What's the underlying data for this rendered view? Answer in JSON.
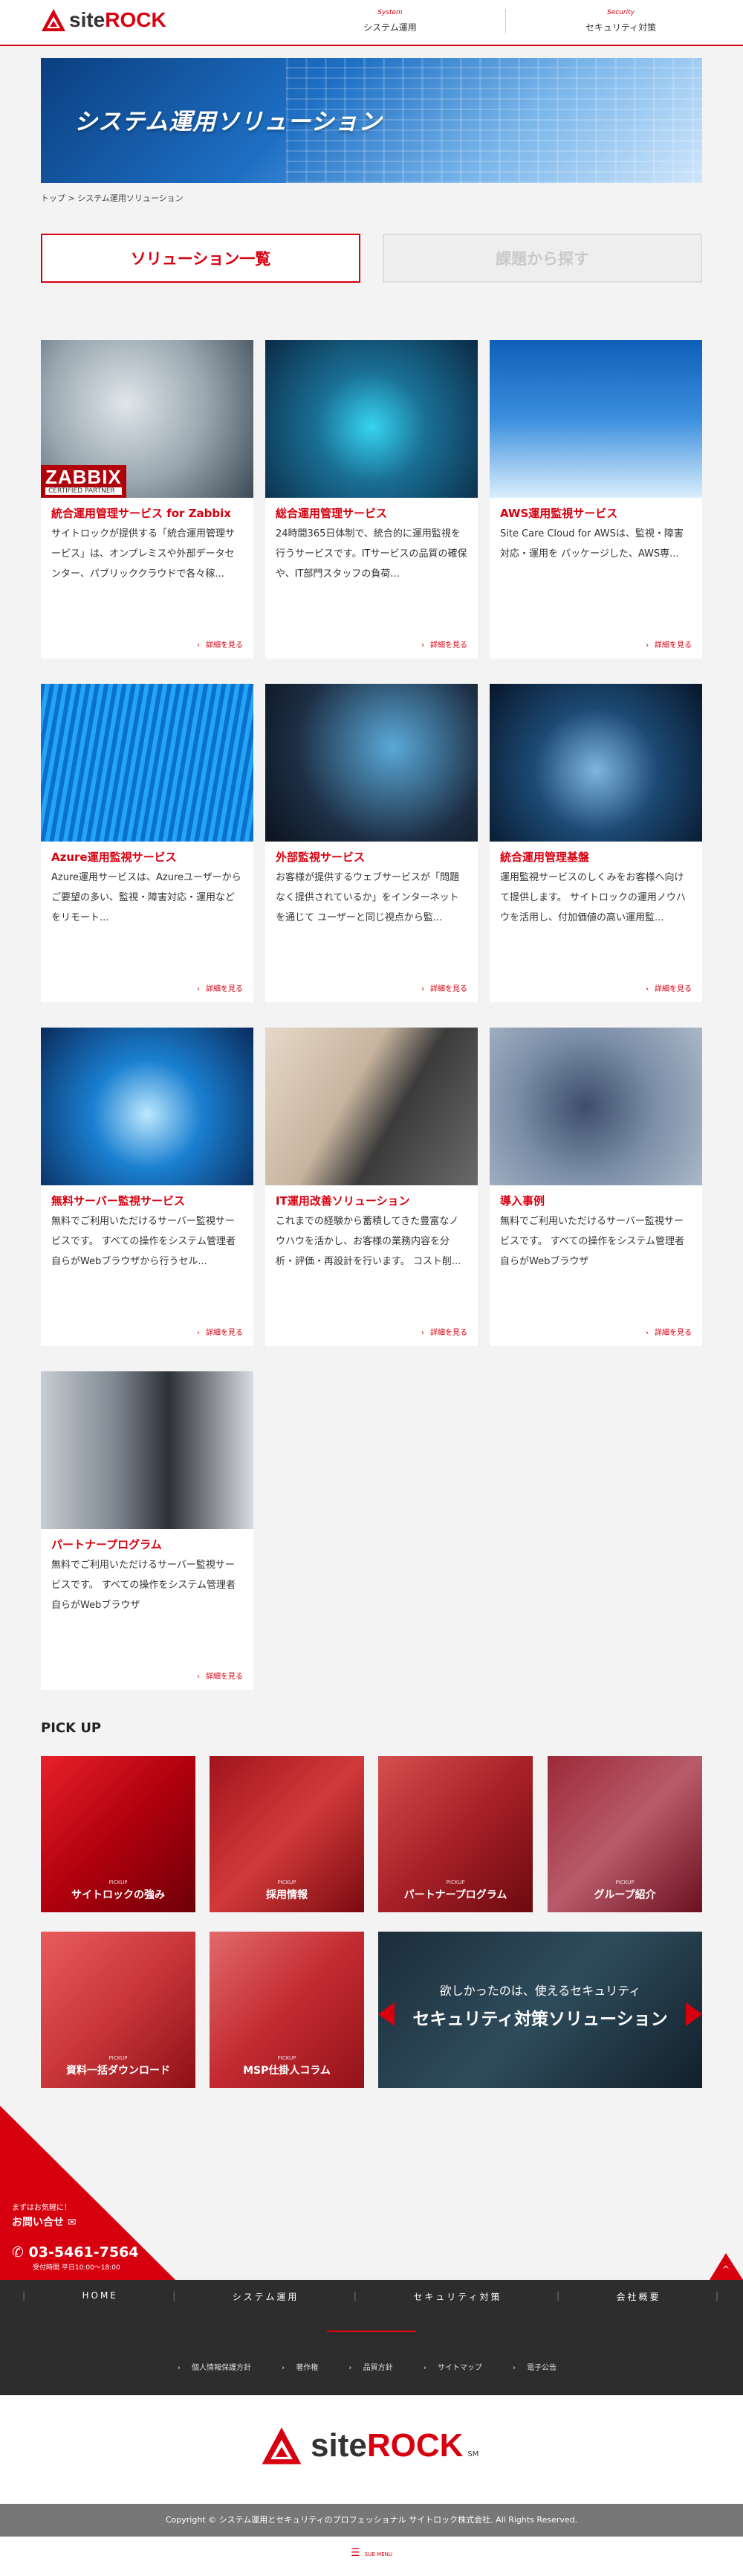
{
  "brand": {
    "logo_site": "site",
    "logo_rock": "ROCK",
    "footer_mark": "SM"
  },
  "gnav": [
    {
      "en": "System",
      "ja": "システム運用"
    },
    {
      "en": "Security",
      "ja": "セキュリティ対策"
    }
  ],
  "hero": {
    "title": "システム運用ソリューション"
  },
  "breadcrumb": "トップ > システム運用ソリューション",
  "tabs": {
    "list": "ソリューション一覧",
    "find": "課題から探す"
  },
  "cards": [
    {
      "title": "統合運用管理サービス for Zabbix",
      "desc": "サイトロックが提供する「統合運用管理サービス」は、オンプレミスや外部データセンター、パブリッククラウドで各々稼...",
      "more": "詳細を見る",
      "badge": "ZABBIX",
      "badge_sub": "CERTIFIED PARTNER"
    },
    {
      "title": "総合運用管理サービス",
      "desc": "24時間365日体制で、統合的に運用監視を行うサービスです。ITサービスの品質の確保や、IT部門スタッフの負荷...",
      "more": "詳細を見る"
    },
    {
      "title": "AWS運用監視サービス",
      "desc": "Site Care Cloud for AWSは、監視・障害対応・運用を パッケージした、AWS専...",
      "more": "詳細を見る"
    },
    {
      "title": "Azure運用監視サービス",
      "desc": "Azure運用サービスは、Azureユーザーからご要望の多い、監視・障害対応・運用などをリモート...",
      "more": "詳細を見る"
    },
    {
      "title": "外部監視サービス",
      "desc": "お客様が提供するウェブサービスが「問題なく提供されているか」をインターネットを通じて ユーザーと同じ視点から監...",
      "more": "詳細を見る"
    },
    {
      "title": "統合運用管理基盤",
      "desc": "運用監視サービスのしくみをお客様へ向けて提供します。 サイトロックの運用ノウハウを活用し、付加価値の高い運用監...",
      "more": "詳細を見る"
    },
    {
      "title": "無料サーバー監視サービス",
      "desc": "無料でご利用いただけるサーバー監視サービスです。 すべての操作をシステム管理者自らがWebブラウザから行うセル...",
      "more": "詳細を見る"
    },
    {
      "title": "IT運用改善ソリューション",
      "desc": "これまでの経験から蓄積してきた豊富なノウハウを活かし、お客様の業務内容を分析・評価・再設計を行います。 コスト削...",
      "more": "詳細を見る"
    },
    {
      "title": "導入事例",
      "desc": "無料でご利用いただけるサーバー監視サービスです。 すべての操作をシステム管理者自らがWebブラウザ",
      "more": "詳細を見る"
    },
    {
      "title": "パートナープログラム",
      "desc": "無料でご利用いただけるサーバー監視サービスです。 すべての操作をシステム管理者自らがWebブラウザ",
      "more": "詳細を見る"
    }
  ],
  "pickup": {
    "heading": "PICK UP",
    "tag": "PICKUP",
    "items": [
      "サイトロックの強み",
      "採用情報",
      "パートナープログラム",
      "グループ紹介",
      "資料一括ダウンロード",
      "MSP仕掛人コラム"
    ],
    "banner_line1": "欲しかったのは、使えるセキュリティ",
    "banner_line2": "セキュリティ対策ソリューション"
  },
  "contact": {
    "line1": "まずはお気軽に！",
    "line2": "お問い合せ",
    "phone": "03-5461-7564",
    "hours": "受付時間 平日10:00～18:00"
  },
  "footer_nav": [
    "HOME",
    "システム運用",
    "セキュリティ対策",
    "会社概要"
  ],
  "footer_links": [
    "個人情報保護方針",
    "著作権",
    "品質方針",
    "サイトマップ",
    "電子公告"
  ],
  "copyright": "Copyright © システム運用とセキュリティのプロフェッショナル サイトロック株式会社. All Rights Reserved.",
  "submenu": "SUB MENU",
  "colors": {
    "accent": "#d7000f",
    "footer_bg": "#2d2d2d"
  },
  "icons": [
    "logo-triangle-icon",
    "mail-icon",
    "phone-icon",
    "arrow-right-icon",
    "arrow-up-icon",
    "hamburger-icon"
  ]
}
